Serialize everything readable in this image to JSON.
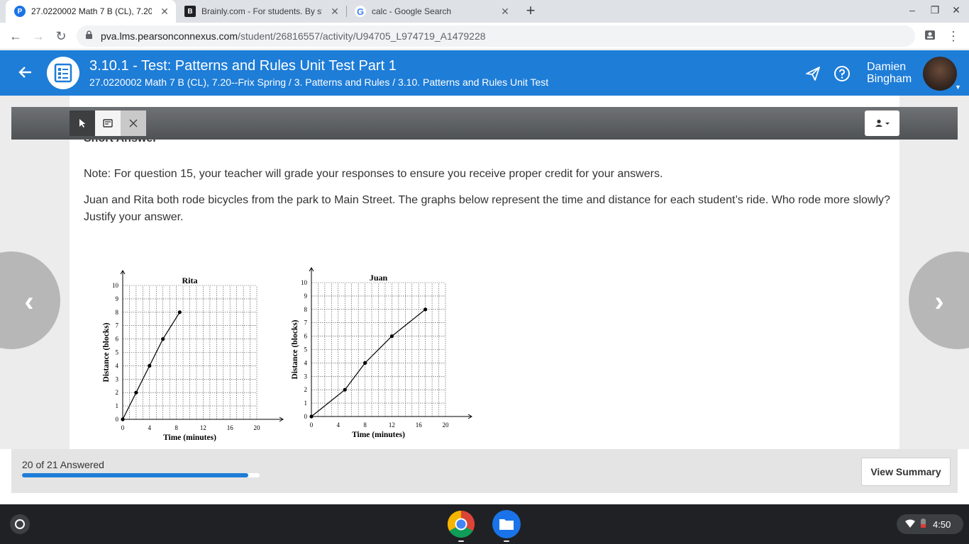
{
  "browser": {
    "tabs": [
      {
        "title": "27.0220002 Math 7 B (CL), 7.20-",
        "favicon": "pearson-icon",
        "active": true
      },
      {
        "title": "Brainly.com - For students. By st",
        "favicon": "brainly-icon",
        "active": false
      },
      {
        "title": "calc - Google Search",
        "favicon": "google-icon",
        "active": false
      }
    ],
    "url_host": "pva.lms.pearsonconnexus.com",
    "url_path": "/student/26816557/activity/U94705_L974719_A1479228"
  },
  "header": {
    "title": "3.10.1 - Test: Patterns and Rules Unit Test Part 1",
    "breadcrumb": "27.0220002 Math 7 B (CL), 7.20--Frix Spring / 3. Patterns and Rules / 3.10. Patterns and Rules Unit Test",
    "user_first": "Damien",
    "user_last": "Bingham",
    "accent": "#1e7dd7"
  },
  "question": {
    "section_label": "Short Answer",
    "note": "Note: For question 15, your teacher will grade your responses to ensure you receive proper credit for your answers.",
    "prompt": "Juan and Rita both rode bicycles from the park to Main Street. The graphs below represent the time and distance for each student’s ride. Who rode more slowly? Justify your answer."
  },
  "chart_data": [
    {
      "type": "line",
      "title": "Rita",
      "xlabel": "Time (minutes)",
      "ylabel": "Distance (blocks)",
      "xlim": [
        0,
        20
      ],
      "ylim": [
        0,
        10
      ],
      "xticks": [
        "0",
        "4",
        "8",
        "12",
        "16",
        "20"
      ],
      "yticks": [
        "0",
        "1",
        "2",
        "3",
        "4",
        "5",
        "6",
        "7",
        "8",
        "9",
        "10"
      ],
      "grid": true,
      "x": [
        0,
        2,
        4,
        6,
        8.5
      ],
      "y": [
        0,
        2,
        4,
        6,
        8
      ]
    },
    {
      "type": "line",
      "title": "Juan",
      "xlabel": "Time (minutes)",
      "ylabel": "Distance (blocks)",
      "xlim": [
        0,
        20
      ],
      "ylim": [
        0,
        10
      ],
      "xticks": [
        "0",
        "4",
        "8",
        "12",
        "16",
        "20"
      ],
      "yticks": [
        "0",
        "1",
        "2",
        "3",
        "4",
        "5",
        "6",
        "7",
        "8",
        "9",
        "10"
      ],
      "grid": true,
      "x": [
        0,
        5,
        8,
        12,
        17
      ],
      "y": [
        0,
        2,
        4,
        6,
        8
      ]
    }
  ],
  "footer": {
    "answered": "20 of 21 Answered",
    "progress_fraction": 0.952,
    "view_summary": "View Summary"
  },
  "shelf": {
    "time": "4:50"
  }
}
